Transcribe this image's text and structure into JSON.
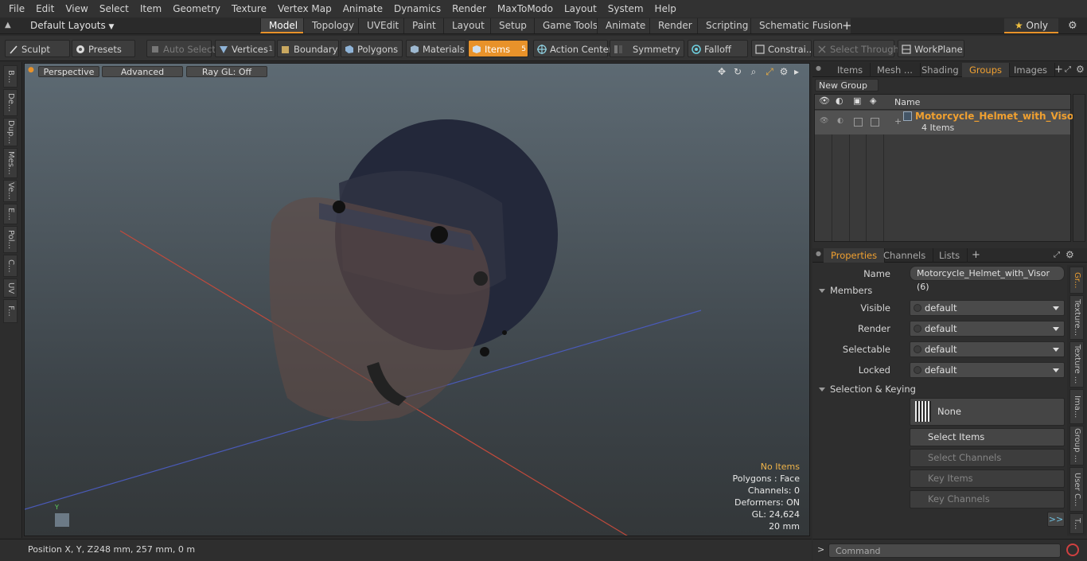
{
  "menu": [
    "File",
    "Edit",
    "View",
    "Select",
    "Item",
    "Geometry",
    "Texture",
    "Vertex Map",
    "Animate",
    "Dynamics",
    "Render",
    "MaxToModo",
    "Layout",
    "System",
    "Help"
  ],
  "layout_selector": "Default Layouts",
  "mode_tabs": [
    "Model",
    "Topology",
    "UVEdit",
    "Paint",
    "Layout",
    "Setup",
    "Game Tools",
    "Animate",
    "Render",
    "Scripting",
    "Schematic Fusion"
  ],
  "only_label": "Only",
  "toolbar": {
    "sculpt": "Sculpt",
    "presets": "Presets",
    "auto_select": "Auto Select",
    "vertices": "Vertices",
    "vertices_count": "1",
    "boundary": "Boundary",
    "polygons": "Polygons",
    "materials": "Materials",
    "items": "Items",
    "items_count": "5",
    "action_center": "Action Center",
    "symmetry": "Symmetry",
    "falloff": "Falloff",
    "constraints": "Constrai...",
    "select_through": "Select Through",
    "workplane": "WorkPlane"
  },
  "left_tabs": [
    "B...",
    "De...",
    "Dup...",
    "Mes...",
    "Ve...",
    "E...",
    "Pol...",
    "C...",
    "UV",
    "F..."
  ],
  "viewport": {
    "perspective": "Perspective",
    "advanced": "Advanced",
    "raygl": "Ray GL: Off",
    "info": {
      "no_items": "No Items",
      "polygons": "Polygons : Face",
      "channels": "Channels: 0",
      "deformers": "Deformers: ON",
      "gl": "GL: 24,624",
      "scale": "20 mm"
    }
  },
  "right_tabs": [
    "Items",
    "Mesh ...",
    "Shading",
    "Groups",
    "Images"
  ],
  "groups": {
    "new_group": "New Group",
    "name_header": "Name",
    "item_name": "Motorcycle_Helmet_with_Visor",
    "item_sub": "4 Items"
  },
  "prop_tabs": [
    "Properties",
    "Channels",
    "Lists"
  ],
  "properties": {
    "name_label": "Name",
    "name_value": "Motorcycle_Helmet_with_Visor (6)",
    "members_header": "Members",
    "visible_label": "Visible",
    "visible_value": "default",
    "render_label": "Render",
    "render_value": "default",
    "selectable_label": "Selectable",
    "selectable_value": "default",
    "locked_label": "Locked",
    "locked_value": "default",
    "selection_header": "Selection & Keying",
    "none_btn": "None",
    "select_items": "Select Items",
    "select_channels": "Select Channels",
    "key_items": "Key Items",
    "key_channels": "Key Channels",
    "more": ">>"
  },
  "right_vtabs": [
    "Gr...",
    "Texture...",
    "Texture ...",
    "Ima...",
    "Group ...",
    "User C...",
    "T..."
  ],
  "status": {
    "position_label": "Position X, Y, Z:",
    "position_value": "248 mm, 257 mm, 0 m"
  },
  "command_placeholder": "Command",
  "colors": {
    "accent": "#e8922a",
    "title_orange": "#f0a030"
  }
}
